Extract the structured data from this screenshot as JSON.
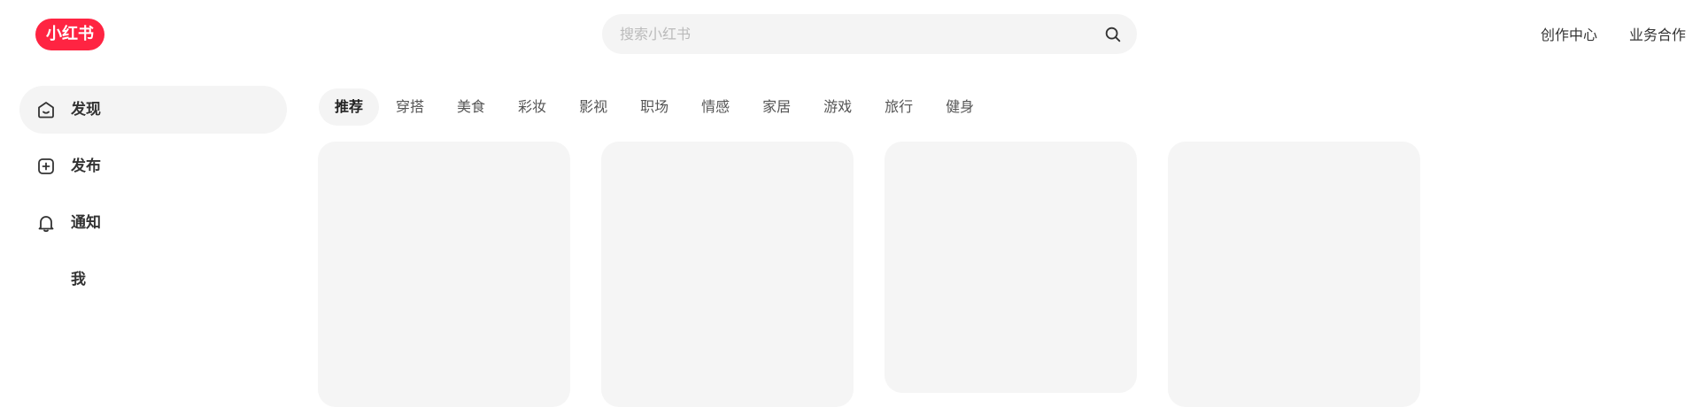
{
  "header": {
    "logo_text": "小红书",
    "search": {
      "placeholder": "搜索小红书",
      "value": "",
      "icon": "search-icon"
    },
    "links": [
      {
        "label": "创作中心"
      },
      {
        "label": "业务合作"
      }
    ]
  },
  "sidebar": {
    "items": [
      {
        "label": "发现",
        "icon": "home-icon",
        "active": true
      },
      {
        "label": "发布",
        "icon": "plus-square-icon",
        "active": false
      },
      {
        "label": "通知",
        "icon": "bell-icon",
        "active": false
      },
      {
        "label": "我",
        "icon": "",
        "active": false
      }
    ]
  },
  "channels": {
    "tabs": [
      {
        "label": "推荐",
        "active": true
      },
      {
        "label": "穿搭"
      },
      {
        "label": "美食"
      },
      {
        "label": "彩妆"
      },
      {
        "label": "影视"
      },
      {
        "label": "职场"
      },
      {
        "label": "情感"
      },
      {
        "label": "家居"
      },
      {
        "label": "游戏"
      },
      {
        "label": "旅行"
      },
      {
        "label": "健身"
      }
    ]
  },
  "feed": {
    "cards": [
      {},
      {},
      {},
      {}
    ]
  },
  "colors": {
    "brand": "#ff2442",
    "surface": "#f4f4f4",
    "text": "#333333",
    "placeholder": "#bbbbbb"
  }
}
